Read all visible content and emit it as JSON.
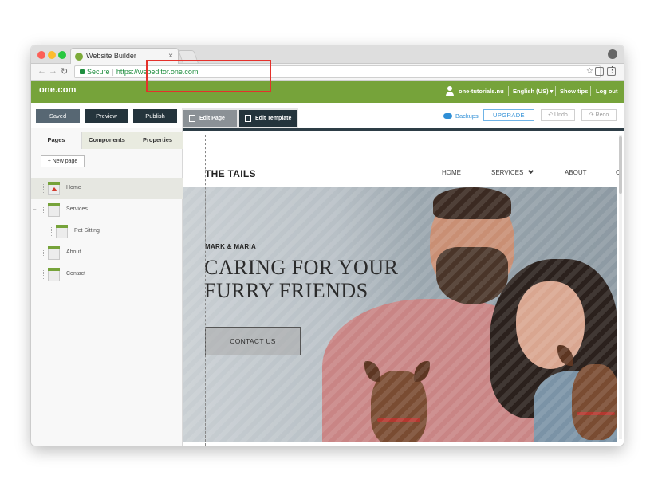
{
  "browser": {
    "tab_title": "Website Builder",
    "tab_close": "×",
    "url_secure": "Secure",
    "url": "https://webeditor.one.com"
  },
  "header": {
    "brand": "one.com",
    "domain": "one-tutorials.nu",
    "language": "English (US) ▾",
    "show_tips": "Show tips",
    "log_out": "Log out",
    "brand_color": "#76a33a"
  },
  "toolbar": {
    "saved": "Saved",
    "preview": "Preview",
    "publish": "Publish",
    "edit_page": "Edit Page",
    "edit_template": "Edit Template",
    "backups": "Backups",
    "upgrade": "UPGRADE",
    "undo": "↶ Undo",
    "redo": "↷ Redo"
  },
  "sidebar": {
    "tabs": [
      "Pages",
      "Components",
      "Properties"
    ],
    "new_page": "+ New page",
    "pages": [
      {
        "label": "Home",
        "selected": true
      },
      {
        "label": "Services",
        "selected": false
      },
      {
        "label": "Pet Sitting",
        "selected": false
      },
      {
        "label": "About",
        "selected": false
      },
      {
        "label": "Contact",
        "selected": false
      }
    ]
  },
  "site": {
    "title": "THE TAILS",
    "nav": [
      "HOME",
      "SERVICES",
      "ABOUT",
      "C"
    ],
    "hero_subtitle": "MARK & MARIA",
    "hero_title": "CARING FOR YOUR FURRY FRIENDS",
    "cta": "CONTACT US"
  }
}
